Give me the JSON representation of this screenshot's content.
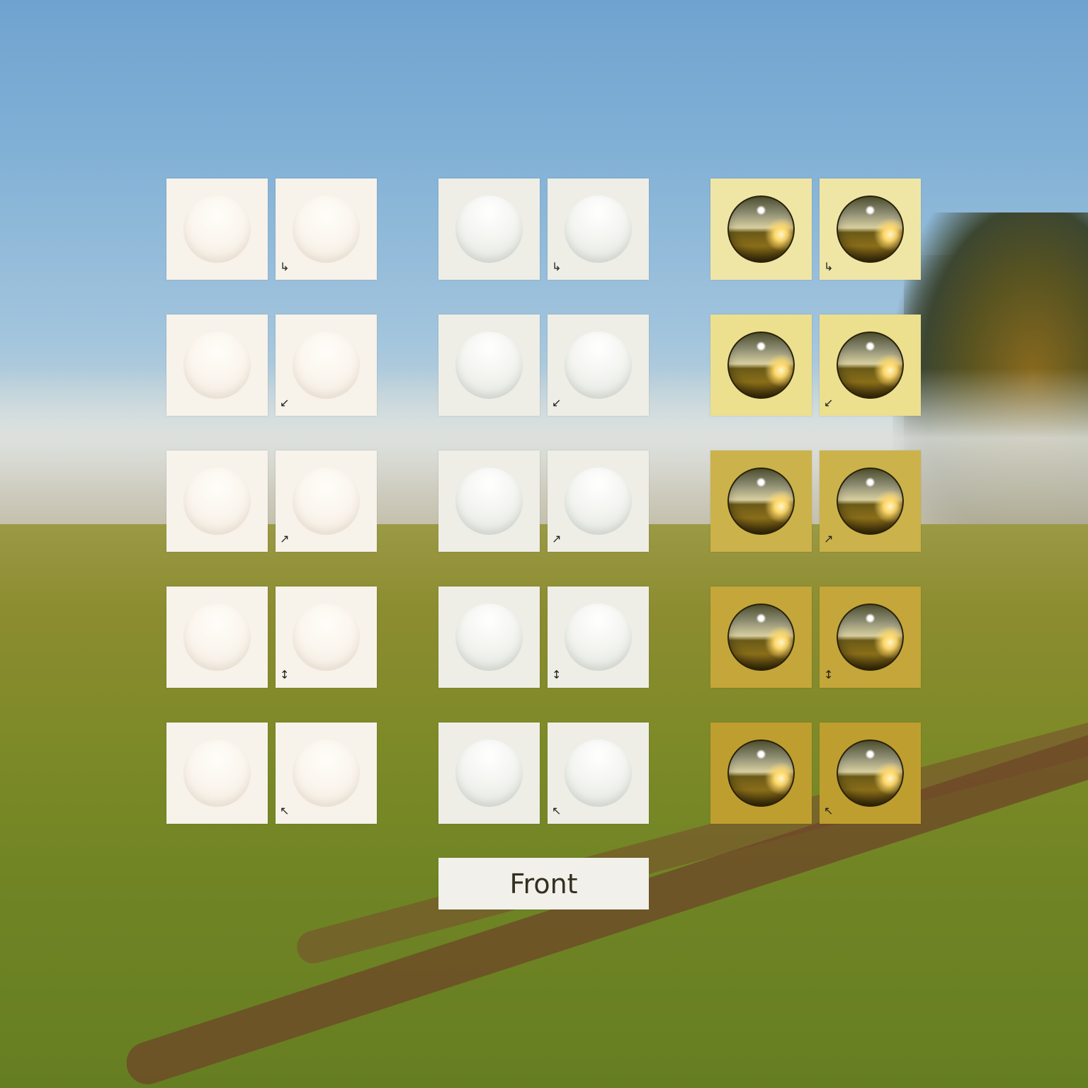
{
  "background": {
    "icon": "misty-meadow-landscape"
  },
  "groups": [
    {
      "name": "group-1",
      "colors": [
        "#f7f2ea",
        "#f7f2ea",
        "#f7f2ea",
        "#f7f2ea",
        "#f7f2ea"
      ],
      "ball_color": "#fbf6ee"
    },
    {
      "name": "group-2",
      "colors": [
        "#eeeee6",
        "#eeeee6",
        "#eeeee6",
        "#eeeee6",
        "#eeeee6"
      ],
      "ball_color": "#f4f5f1"
    },
    {
      "name": "group-3",
      "colors": [
        "#efe6a6",
        "#ece08e",
        "#ccb24a",
        "#c4a63a",
        "#bf9e30"
      ],
      "ball_color": "#8a6e1a"
    }
  ],
  "rows": [
    {
      "axes_glyph": "↳"
    },
    {
      "axes_glyph": "↙"
    },
    {
      "axes_glyph": "↗"
    },
    {
      "axes_glyph": "↕"
    },
    {
      "axes_glyph": "↖"
    }
  ],
  "front_button": {
    "label": "Front"
  }
}
